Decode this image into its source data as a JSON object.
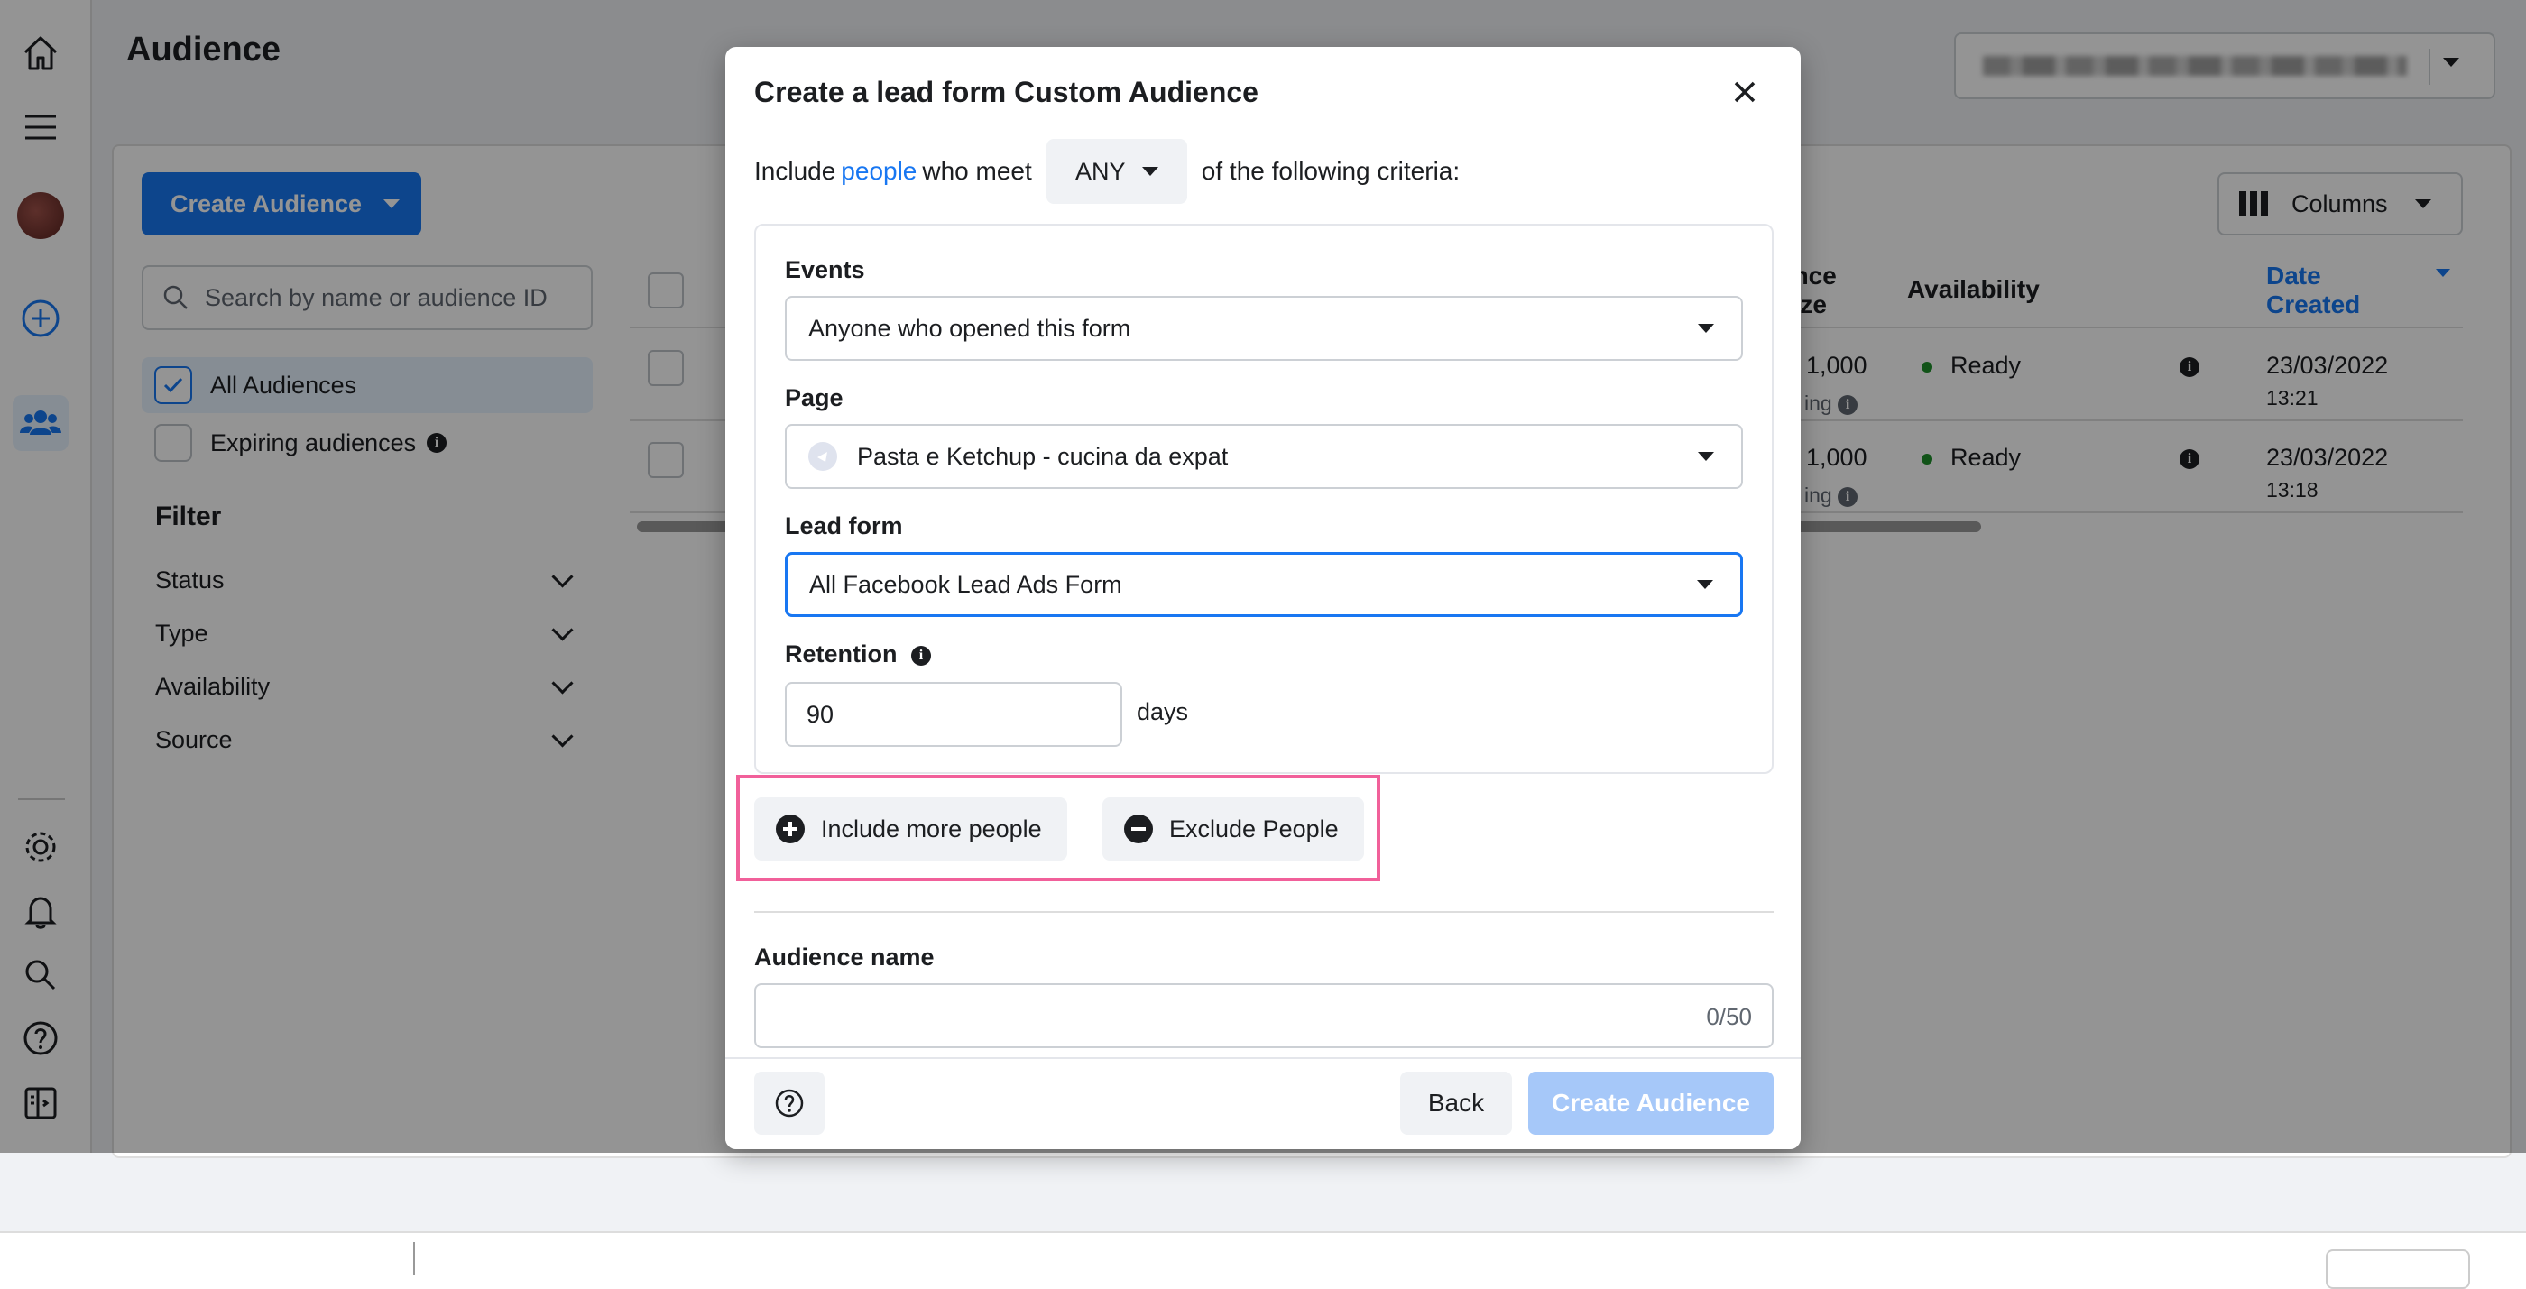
{
  "page": {
    "title": "Audience"
  },
  "toolbar": {
    "create_audience": "Create Audience",
    "columns": "Columns"
  },
  "search": {
    "placeholder": "Search by name or audience ID"
  },
  "sidebar_filters": {
    "all": "All Audiences",
    "expiring": "Expiring audiences",
    "filter_title": "Filter",
    "items": [
      "Status",
      "Type",
      "Availability",
      "Source"
    ]
  },
  "table": {
    "headers": {
      "size": "ence\nsize",
      "availability": "Availability",
      "date": "Date\nCreated"
    },
    "rows": [
      {
        "size": "1,000",
        "size_sub": "ing",
        "availability": "Ready",
        "date": "23/03/2022",
        "time": "13:21"
      },
      {
        "size": "1,000",
        "size_sub": "ing",
        "availability": "Ready",
        "date": "23/03/2022",
        "time": "13:18"
      }
    ]
  },
  "modal": {
    "title": "Create a lead form Custom Audience",
    "criteria": {
      "include": "Include",
      "people_link": "people",
      "who_meet": "who meet",
      "any": "ANY",
      "following": "of the following criteria:"
    },
    "events_label": "Events",
    "events_value": "Anyone who opened this form",
    "page_label": "Page",
    "page_value": "Pasta e Ketchup - cucina da expat",
    "lead_form_label": "Lead form",
    "lead_form_value": "All Facebook Lead Ads Form",
    "retention_label": "Retention",
    "retention_value": "90",
    "retention_unit": "days",
    "include_more": "Include more people",
    "exclude": "Exclude People",
    "audience_name_label": "Audience name",
    "audience_name_counter": "0/50",
    "back": "Back",
    "create": "Create Audience"
  },
  "colors": {
    "accent": "#1877f2",
    "highlight": "#f1609a",
    "ready": "#1e8f2a"
  }
}
